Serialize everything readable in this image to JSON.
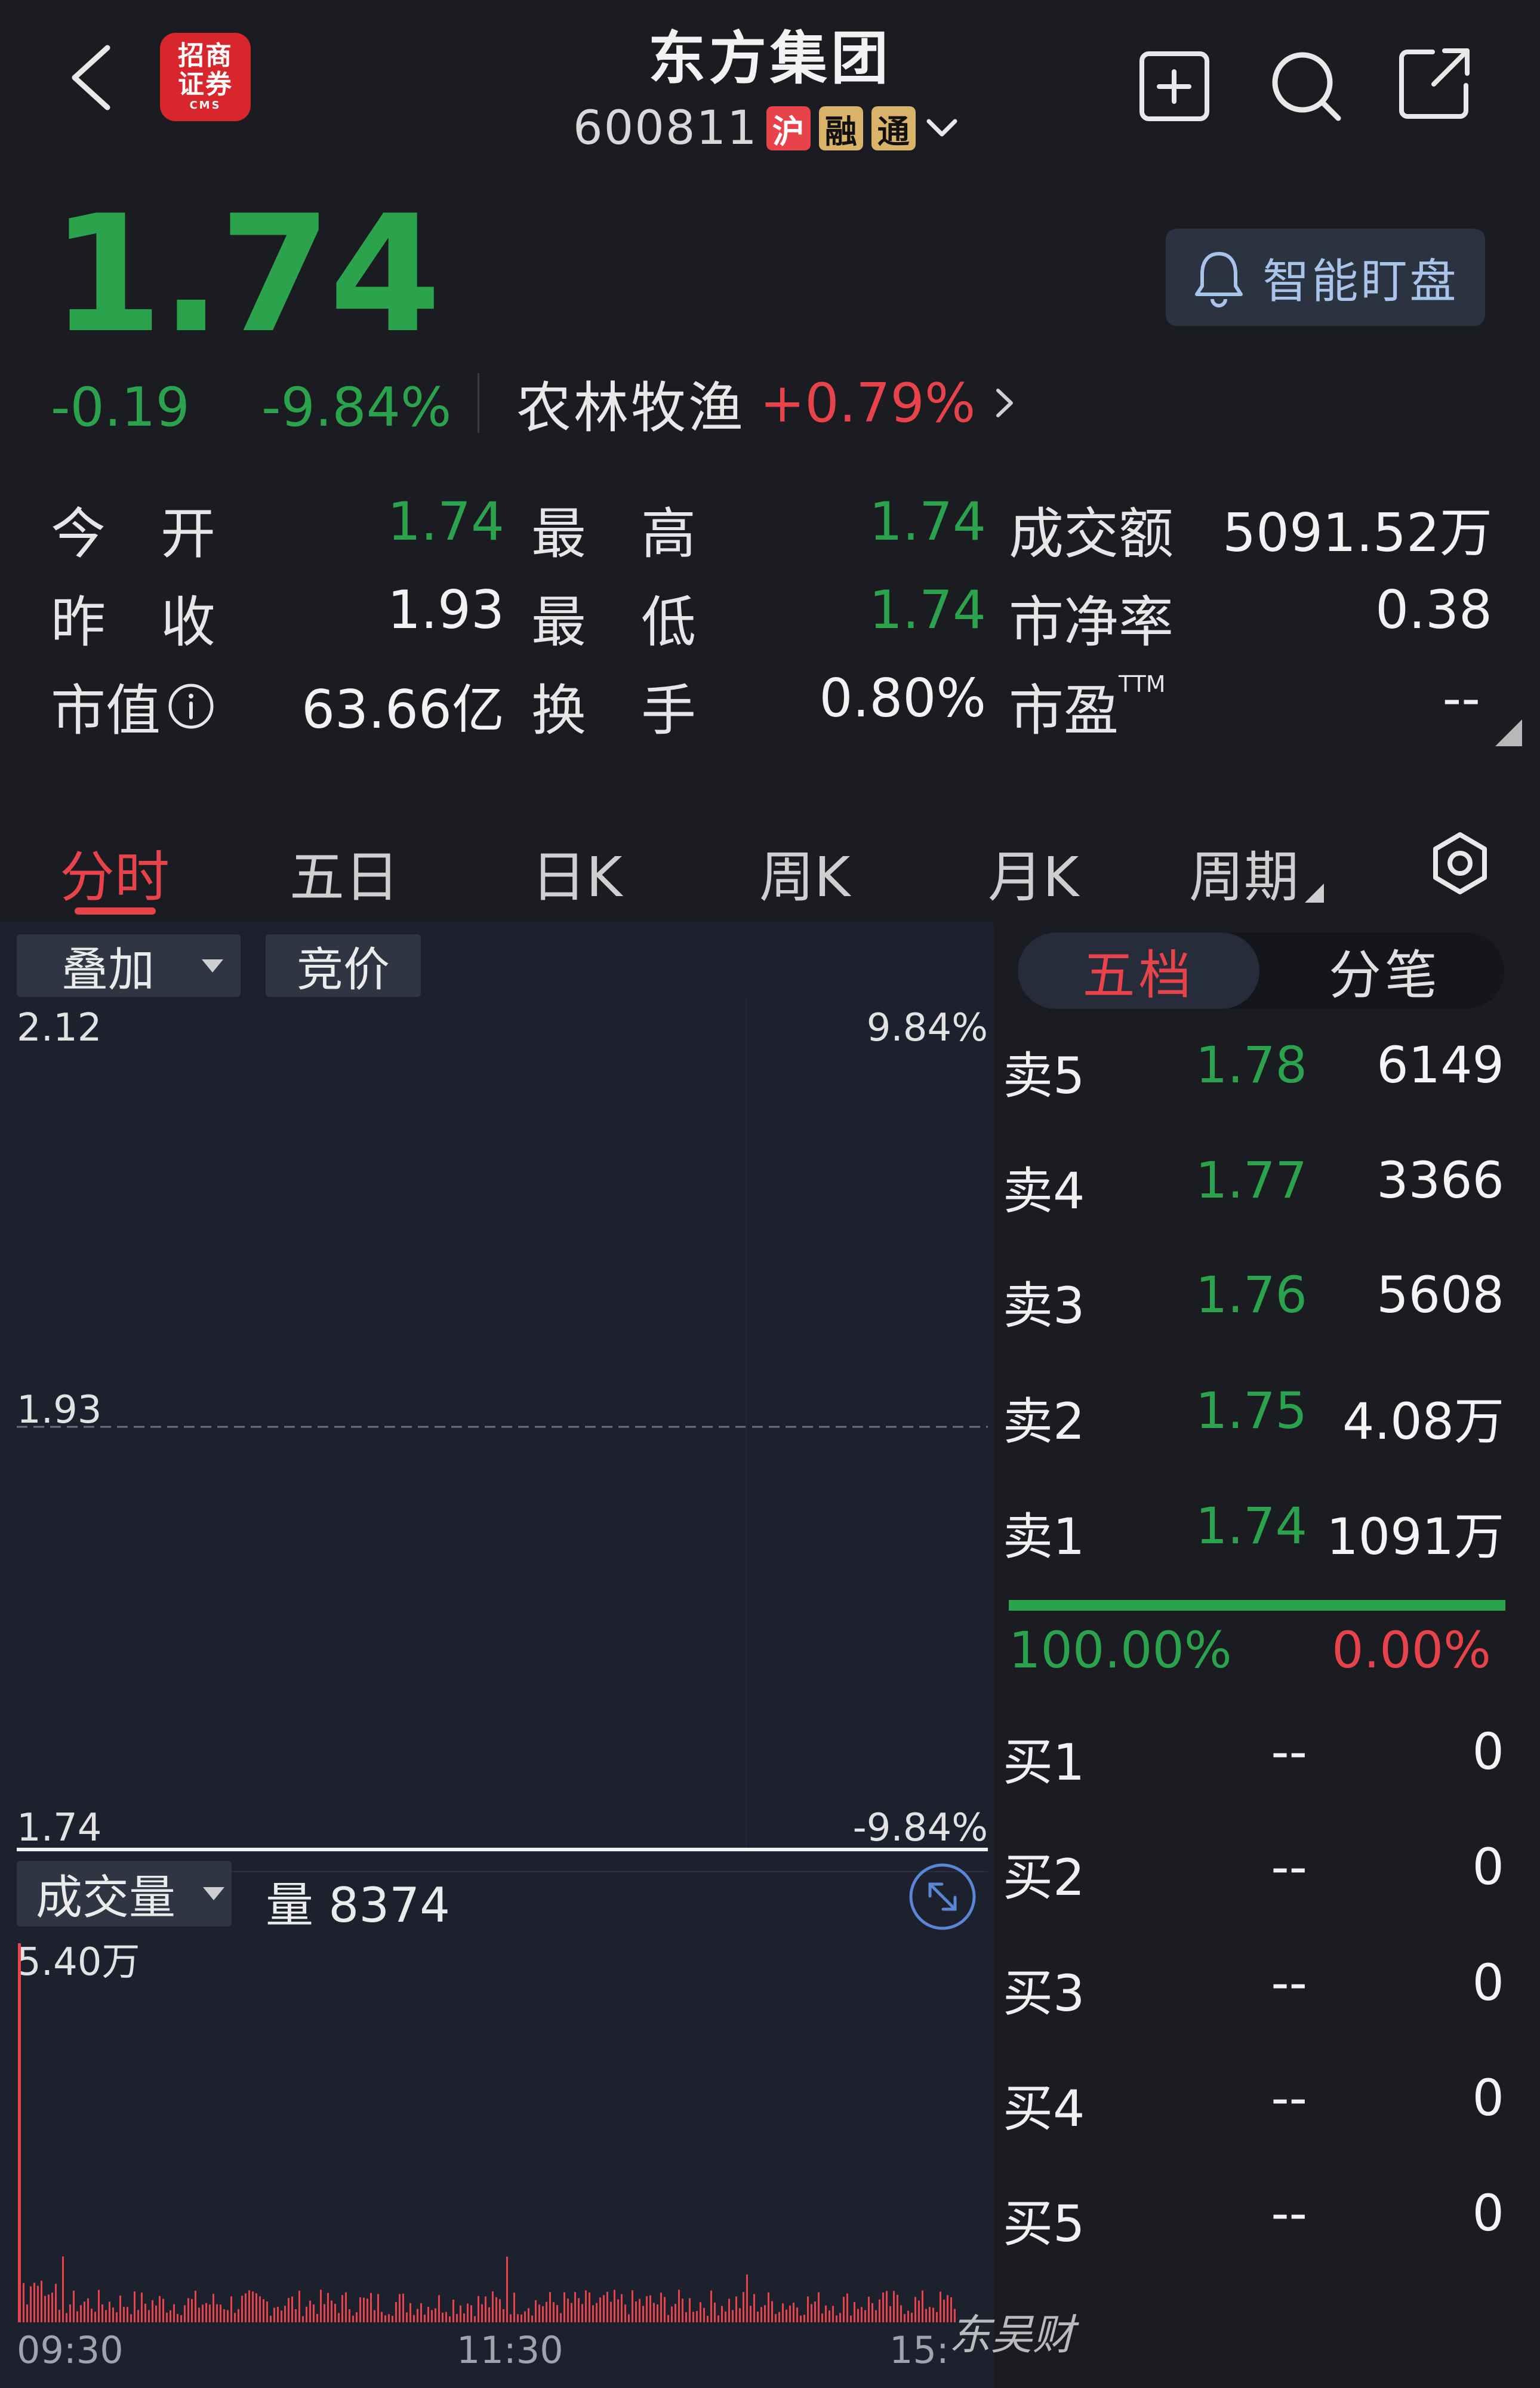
{
  "header": {
    "logo_line1": "招商",
    "logo_line2": "证券",
    "logo_line3": "CMS",
    "stock_name": "东方集团",
    "stock_code": "600811",
    "tags": [
      "沪",
      "融",
      "通"
    ]
  },
  "quote": {
    "price": "1.74",
    "change": "-0.19",
    "change_pct": "-9.84%",
    "sector_name": "农林牧渔",
    "sector_change": "+0.79%",
    "alert_label": "智能盯盘",
    "colors": {
      "down": "#2ba24c",
      "up": "#e8434a"
    }
  },
  "stats": [
    {
      "label": "今　开",
      "value": "1.74",
      "color": "green"
    },
    {
      "label": "最　高",
      "value": "1.74",
      "color": "green"
    },
    {
      "label": "成交额",
      "value": "5091.52万",
      "color": "white"
    },
    {
      "label": "昨　收",
      "value": "1.93",
      "color": "white"
    },
    {
      "label": "最　低",
      "value": "1.74",
      "color": "green"
    },
    {
      "label": "市净率",
      "value": "0.38",
      "color": "white"
    },
    {
      "label": "市值",
      "value": "63.66亿",
      "color": "white"
    },
    {
      "label": "换　手",
      "value": "0.80%",
      "color": "white"
    },
    {
      "label": "市盈",
      "label_sup": "TTM",
      "value": "--",
      "color": "white"
    }
  ],
  "tabs": [
    "分时",
    "五日",
    "日K",
    "周K",
    "月K",
    "周期"
  ],
  "active_tab": "分时",
  "chart": {
    "overlay_label": "叠加",
    "auction_label": "竞价",
    "price_high": "2.12",
    "price_mid": "1.93",
    "price_low": "1.74",
    "pct_high": "9.84%",
    "pct_low": "-9.84%",
    "volume_selector": "成交量",
    "volume_current": "量 8374",
    "volume_max": "5.40万",
    "time_labels": [
      "09:30",
      "11:30",
      "15:"
    ],
    "watermark": "东吴财"
  },
  "order_book": {
    "tab_active": "五档",
    "tab_other": "分笔",
    "asks": [
      {
        "label": "卖5",
        "price": "1.78",
        "volume": "6149"
      },
      {
        "label": "卖4",
        "price": "1.77",
        "volume": "3366"
      },
      {
        "label": "卖3",
        "price": "1.76",
        "volume": "5608"
      },
      {
        "label": "卖2",
        "price": "1.75",
        "volume": "4.08万"
      },
      {
        "label": "卖1",
        "price": "1.74",
        "volume": "1091万"
      }
    ],
    "ratio_buy": "100.00%",
    "ratio_sell": "0.00%",
    "bids": [
      {
        "label": "买1",
        "price": "--",
        "volume": "0"
      },
      {
        "label": "买2",
        "price": "--",
        "volume": "0"
      },
      {
        "label": "买3",
        "price": "--",
        "volume": "0"
      },
      {
        "label": "买4",
        "price": "--",
        "volume": "0"
      },
      {
        "label": "买5",
        "price": "--",
        "volume": "0"
      }
    ]
  },
  "icons": [
    "back-arrow-icon",
    "add-icon",
    "search-icon",
    "share-icon",
    "bell-icon",
    "gear-icon",
    "fullscreen-icon",
    "chevron-down-icon",
    "chevron-right-icon",
    "info-icon"
  ]
}
